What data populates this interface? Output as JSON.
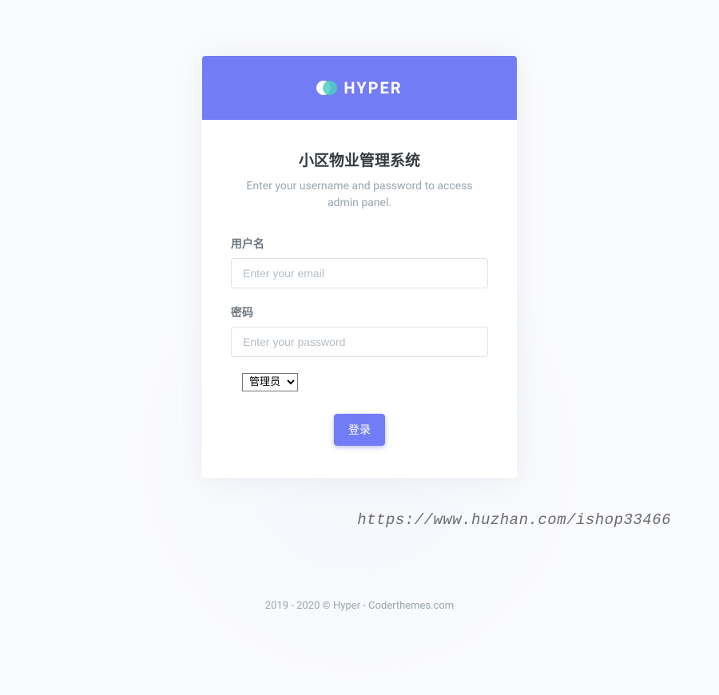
{
  "header": {
    "brand": "HYPER"
  },
  "login": {
    "title": "小区物业管理系统",
    "subtitle": "Enter your username and password to access admin panel.",
    "username_label": "用户名",
    "username_placeholder": "Enter your email",
    "password_label": "密码",
    "password_placeholder": "Enter your password",
    "role_selected": "管理员",
    "submit_label": "登录"
  },
  "watermark": "https://www.huzhan.com/ishop33466",
  "footer": "2019 - 2020 © Hyper - Coderthemes.com"
}
